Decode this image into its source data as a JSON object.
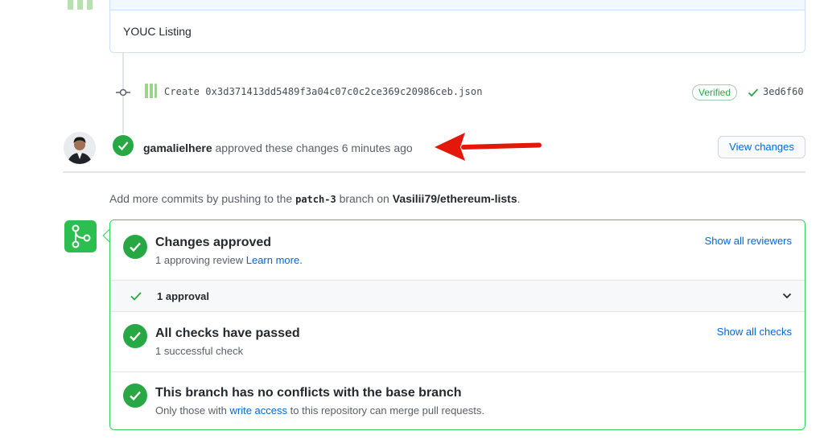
{
  "comment": {
    "body": "YOUC Listing"
  },
  "commit": {
    "message": "Create 0x3d371413dd5489f3a04c07c0c2ce369c20986ceb.json",
    "verified_label": "Verified",
    "sha": "3ed6f60"
  },
  "review": {
    "user": "gamalielhere",
    "action": " approved these changes ",
    "time": "6 minutes ago",
    "view_changes_label": "View changes"
  },
  "add_commits": {
    "prefix": "Add more commits by pushing to the ",
    "branch": "patch-3",
    "middle": " branch on ",
    "repo": "Vasilii79/ethereum-lists",
    "suffix": "."
  },
  "merge": {
    "approved": {
      "title": "Changes approved",
      "subtitle_prefix": "1 approving review ",
      "learn_more": "Learn more.",
      "show_reviewers": "Show all reviewers"
    },
    "approvals": {
      "label": "1 approval"
    },
    "checks": {
      "title": "All checks have passed",
      "subtitle": "1 successful check",
      "show_checks": "Show all checks"
    },
    "conflicts": {
      "title": "This branch has no conflicts with the base branch",
      "subtitle_prefix": "Only those with ",
      "write_access": "write access",
      "subtitle_suffix": " to this repository can merge pull requests."
    }
  },
  "colors": {
    "success": "#28a745",
    "link": "#0366d6",
    "arrow": "#e3170a"
  }
}
